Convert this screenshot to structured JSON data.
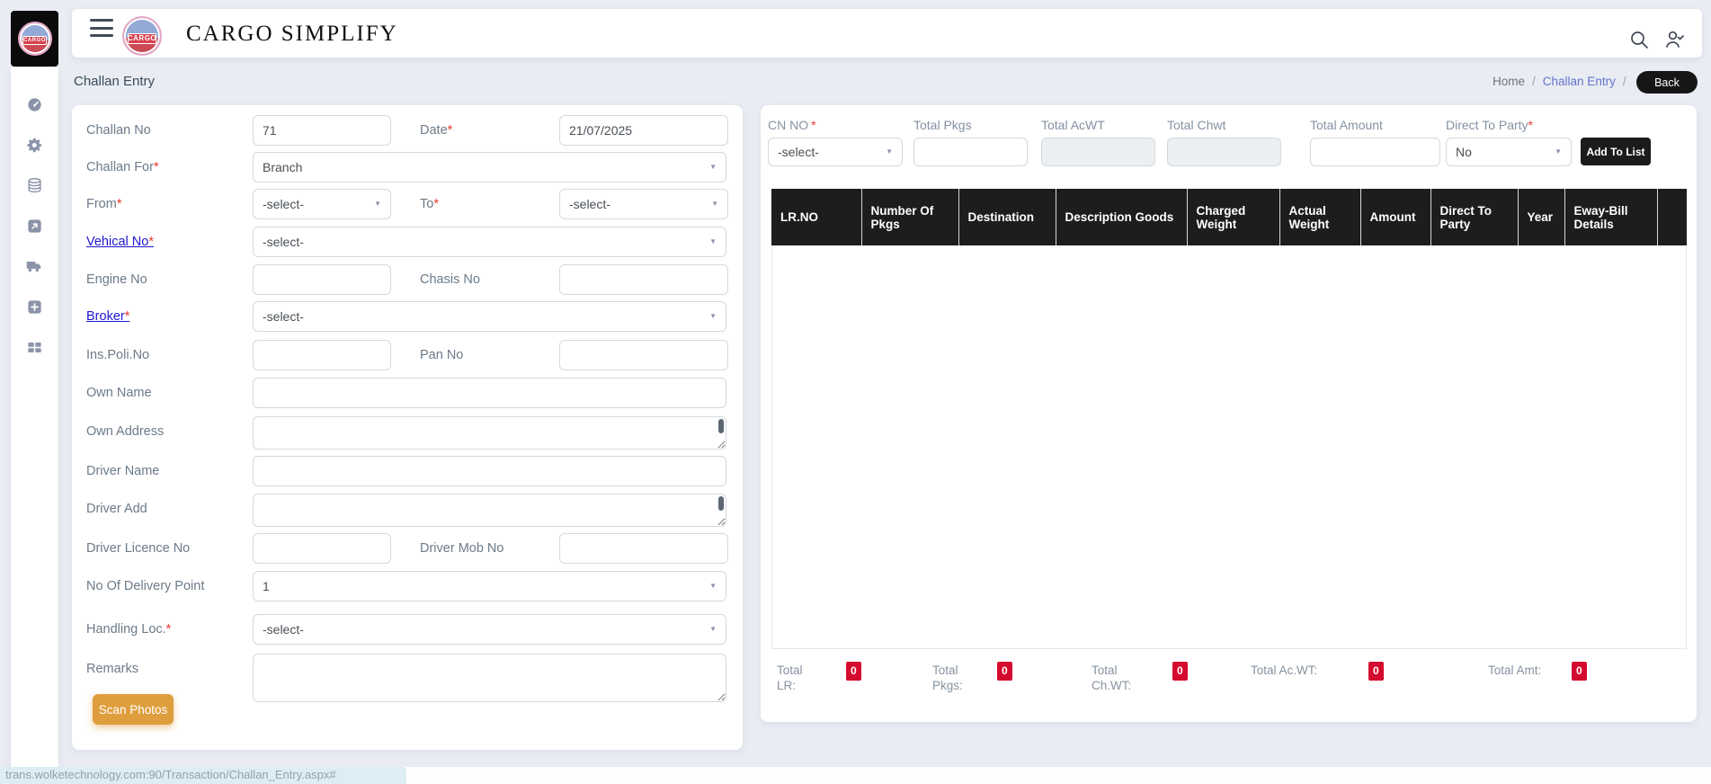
{
  "header": {
    "brand": "CARGO SIMPLIFY",
    "logo_text": "CARGO"
  },
  "breadcrumb": {
    "home": "Home",
    "separator": "/",
    "current": "Challan Entry",
    "trailing_separator": "/"
  },
  "page_title": "Challan Entry",
  "back_button": "Back",
  "left_form": {
    "rows": [
      {
        "label": "Challan No",
        "value": "71",
        "label2": "Date",
        "required2": "*",
        "value2": "21/07/2025"
      },
      {
        "label": "Challan For",
        "required": "*",
        "value": "Branch"
      },
      {
        "label": "From",
        "required": "*",
        "value": "-select-",
        "label2": "To",
        "required2": "*",
        "value2": "-select-"
      },
      {
        "label": "Vehical No",
        "required": "*",
        "value": "-select-"
      },
      {
        "label": "Engine No",
        "value": "",
        "label2": "Chasis No",
        "value2": ""
      },
      {
        "label": "Broker",
        "required": "*",
        "value": "-select-"
      },
      {
        "label": "Ins.Poli.No",
        "value": "",
        "label2": "Pan No",
        "value2": ""
      },
      {
        "label": "Own Name",
        "value": ""
      },
      {
        "label": "Own Address",
        "value": ""
      },
      {
        "label": "Driver Name",
        "value": ""
      },
      {
        "label": "Driver Add",
        "value": ""
      },
      {
        "label": "Driver Licence No",
        "value": "",
        "label2": "Driver Mob No",
        "value2": ""
      },
      {
        "label": "No Of Delivery Point",
        "value": "1"
      },
      {
        "label": "Handling Loc.",
        "required": "*",
        "value": "-select-"
      },
      {
        "label": "Remarks",
        "value": ""
      }
    ],
    "scan_photos_button": "Scan Photos"
  },
  "right_panel": {
    "cn_no": {
      "label": "CN NO",
      "required": "*",
      "value": "-select-"
    },
    "total_pkgs": {
      "label": "Total Pkgs",
      "value": ""
    },
    "total_acwt": {
      "label": "Total AcWT",
      "value": ""
    },
    "total_chwt": {
      "label": "Total Chwt",
      "value": ""
    },
    "total_amount": {
      "label": "Total Amount",
      "value": ""
    },
    "direct_to_party": {
      "label": "Direct To Party",
      "required": "*",
      "value": "No"
    },
    "add_to_list_button": "Add To List",
    "table": {
      "columns": [
        "LR.NO",
        "Number Of Pkgs",
        "Destination",
        "Description Goods",
        "Charged Weight",
        "Actual Weight",
        "Amount",
        "Direct To Party",
        "Year",
        "Eway-Bill Details",
        ""
      ]
    },
    "totals": [
      {
        "label": "Total LR:",
        "value": "0"
      },
      {
        "label": "Total Pkgs:",
        "value": "0"
      },
      {
        "label": "Total Ch.WT:",
        "value": "0"
      },
      {
        "label": "Total Ac.WT:",
        "value": "0"
      },
      {
        "label": "Total Amt:",
        "value": "0"
      }
    ]
  },
  "statusbar": {
    "url": "trans.wolketechnology.com:90/Transaction/Challan_Entry.aspx#"
  },
  "colors": {
    "accent_orange": "#df9e3e",
    "button_black": "#1b1b1b",
    "table_header": "#1c1c1c",
    "badge_red": "#d40b2e",
    "link_blue": "#2016cf",
    "breadcrumb_link": "#6571ce",
    "required_red": "#e8382e"
  }
}
